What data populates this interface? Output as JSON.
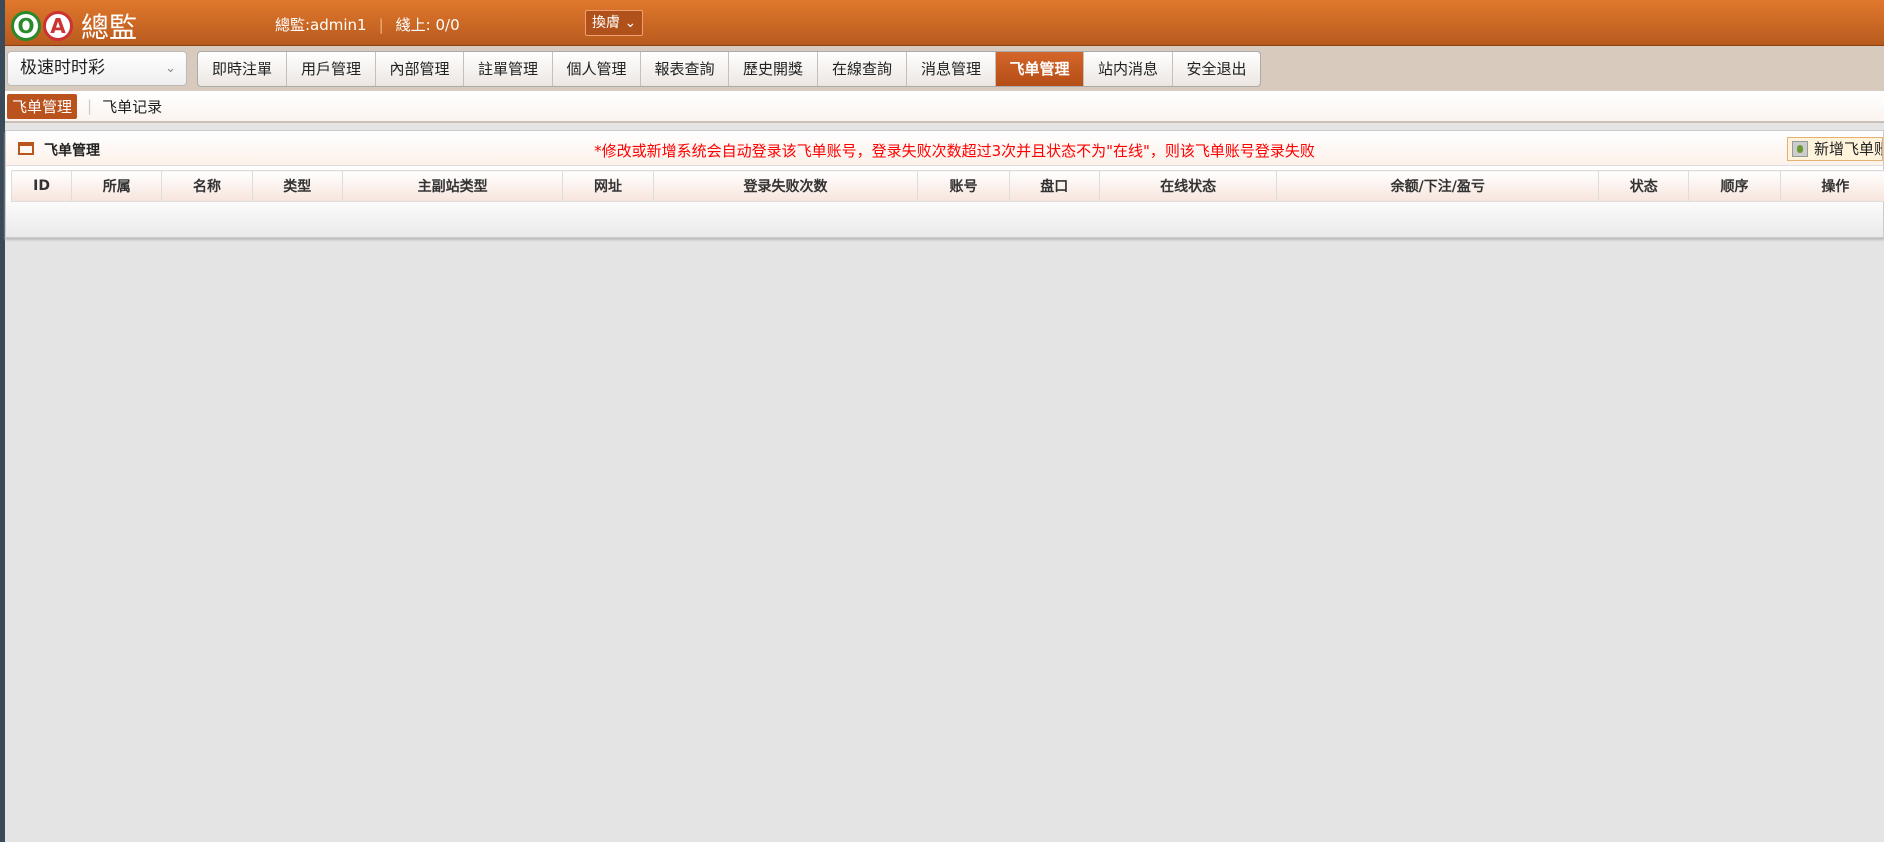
{
  "header": {
    "logo_text": "OA",
    "title": "總監",
    "user": "總監:admin1",
    "online": "綫上: 0/0",
    "skin_label": "換膚"
  },
  "lottery_select": "极速时时彩",
  "tabs": [
    "即時注單",
    "用戶管理",
    "內部管理",
    "註單管理",
    "個人管理",
    "報表查詢",
    "歷史開獎",
    "在線查詢",
    "消息管理",
    "飞单管理",
    "站内消息",
    "安全退出"
  ],
  "active_tab": "飞单管理",
  "subnav": {
    "items": [
      "飞单管理",
      "飞单记录"
    ],
    "active": "飞单管理"
  },
  "panel": {
    "title": "飞单管理",
    "note": "*修改或新增系统会自动登录该飞单账号，登录失败次数超过3次并且状态不为\"在线\"，则该飞单账号登录失败",
    "add_button": "新增飞单账号"
  },
  "table": {
    "columns": [
      "ID",
      "所属",
      "名称",
      "类型",
      "主副站类型",
      "网址",
      "登录失败次数",
      "账号",
      "盘口",
      "在线状态",
      "余额/下注/盈亏",
      "状态",
      "顺序",
      "操作"
    ],
    "rows": []
  },
  "colors": {
    "accent": "#b9521c",
    "note": "#ff0000"
  }
}
